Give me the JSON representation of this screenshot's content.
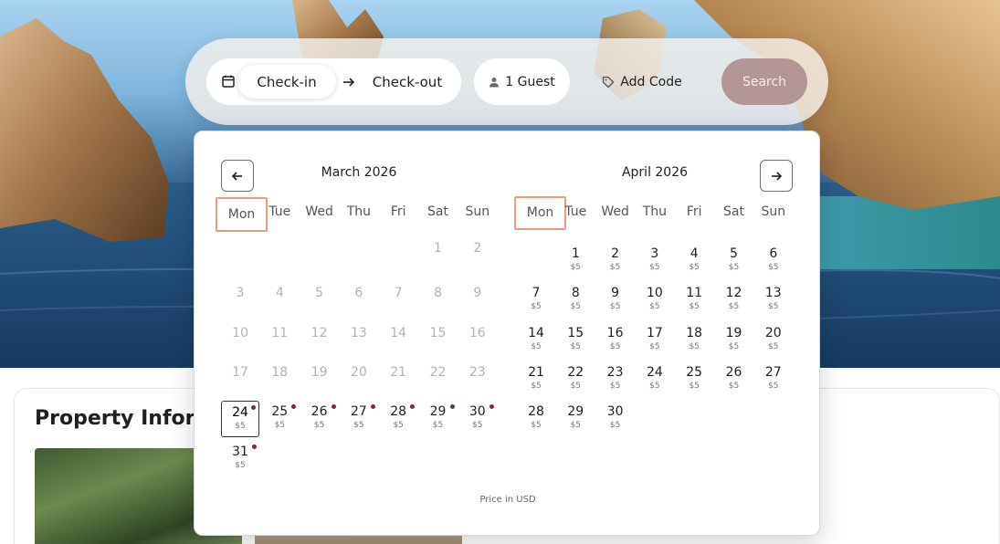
{
  "search_bar": {
    "check_in_label": "Check-in",
    "check_out_label": "Check-out",
    "guests_label": "1 Guest",
    "add_code_label": "Add Code",
    "search_label": "Search"
  },
  "property": {
    "title": "Property Informe"
  },
  "calendar": {
    "price_note": "Price in USD",
    "weekdays": [
      "Mon",
      "Tue",
      "Wed",
      "Thu",
      "Fri",
      "Sat",
      "Sun"
    ],
    "months": [
      {
        "title": "March 2026",
        "first_weekday": 6,
        "days": [
          {
            "n": "1",
            "price": "",
            "state": "past",
            "dot": false
          },
          {
            "n": "2",
            "price": "",
            "state": "past",
            "dot": false
          },
          {
            "n": "3",
            "price": "",
            "state": "past",
            "dot": false
          },
          {
            "n": "4",
            "price": "",
            "state": "past",
            "dot": false
          },
          {
            "n": "5",
            "price": "",
            "state": "past",
            "dot": false
          },
          {
            "n": "6",
            "price": "",
            "state": "past",
            "dot": false
          },
          {
            "n": "7",
            "price": "",
            "state": "past",
            "dot": false
          },
          {
            "n": "8",
            "price": "",
            "state": "past",
            "dot": false
          },
          {
            "n": "9",
            "price": "",
            "state": "past",
            "dot": false
          },
          {
            "n": "10",
            "price": "",
            "state": "past",
            "dot": false
          },
          {
            "n": "11",
            "price": "",
            "state": "past",
            "dot": false
          },
          {
            "n": "12",
            "price": "",
            "state": "past",
            "dot": false
          },
          {
            "n": "13",
            "price": "",
            "state": "past",
            "dot": false
          },
          {
            "n": "14",
            "price": "",
            "state": "past",
            "dot": false
          },
          {
            "n": "15",
            "price": "",
            "state": "past",
            "dot": false
          },
          {
            "n": "16",
            "price": "",
            "state": "past",
            "dot": false
          },
          {
            "n": "17",
            "price": "",
            "state": "past",
            "dot": false
          },
          {
            "n": "18",
            "price": "",
            "state": "past",
            "dot": false
          },
          {
            "n": "19",
            "price": "",
            "state": "past",
            "dot": false
          },
          {
            "n": "20",
            "price": "",
            "state": "past",
            "dot": false
          },
          {
            "n": "21",
            "price": "",
            "state": "past",
            "dot": false
          },
          {
            "n": "22",
            "price": "",
            "state": "past",
            "dot": false
          },
          {
            "n": "23",
            "price": "",
            "state": "past",
            "dot": false
          },
          {
            "n": "24",
            "price": "$5",
            "state": "selected",
            "dot": true
          },
          {
            "n": "25",
            "price": "$5",
            "state": "avail",
            "dot": true
          },
          {
            "n": "26",
            "price": "$5",
            "state": "avail",
            "dot": true
          },
          {
            "n": "27",
            "price": "$5",
            "state": "avail",
            "dot": true
          },
          {
            "n": "28",
            "price": "$5",
            "state": "avail",
            "dot": true
          },
          {
            "n": "29",
            "price": "$5",
            "state": "avail",
            "dot": true
          },
          {
            "n": "30",
            "price": "$5",
            "state": "avail",
            "dot": true
          },
          {
            "n": "31",
            "price": "$5",
            "state": "avail",
            "dot": true
          }
        ]
      },
      {
        "title": "April 2026",
        "first_weekday": 2,
        "days": [
          {
            "n": "1",
            "price": "$5",
            "state": "avail",
            "dot": false
          },
          {
            "n": "2",
            "price": "$5",
            "state": "avail",
            "dot": false
          },
          {
            "n": "3",
            "price": "$5",
            "state": "avail",
            "dot": false
          },
          {
            "n": "4",
            "price": "$5",
            "state": "avail",
            "dot": false
          },
          {
            "n": "5",
            "price": "$5",
            "state": "avail",
            "dot": false
          },
          {
            "n": "6",
            "price": "$5",
            "state": "avail",
            "dot": false
          },
          {
            "n": "7",
            "price": "$5",
            "state": "avail",
            "dot": false
          },
          {
            "n": "8",
            "price": "$5",
            "state": "avail",
            "dot": false
          },
          {
            "n": "9",
            "price": "$5",
            "state": "avail",
            "dot": false
          },
          {
            "n": "10",
            "price": "$5",
            "state": "avail",
            "dot": false
          },
          {
            "n": "11",
            "price": "$5",
            "state": "avail",
            "dot": false
          },
          {
            "n": "12",
            "price": "$5",
            "state": "avail",
            "dot": false
          },
          {
            "n": "13",
            "price": "$5",
            "state": "avail",
            "dot": false
          },
          {
            "n": "14",
            "price": "$5",
            "state": "avail",
            "dot": false
          },
          {
            "n": "15",
            "price": "$5",
            "state": "avail",
            "dot": false
          },
          {
            "n": "16",
            "price": "$5",
            "state": "avail",
            "dot": false
          },
          {
            "n": "17",
            "price": "$5",
            "state": "avail",
            "dot": false
          },
          {
            "n": "18",
            "price": "$5",
            "state": "avail",
            "dot": false
          },
          {
            "n": "19",
            "price": "$5",
            "state": "avail",
            "dot": false
          },
          {
            "n": "20",
            "price": "$5",
            "state": "avail",
            "dot": false
          },
          {
            "n": "21",
            "price": "$5",
            "state": "avail",
            "dot": false
          },
          {
            "n": "22",
            "price": "$5",
            "state": "avail",
            "dot": false
          },
          {
            "n": "23",
            "price": "$5",
            "state": "avail",
            "dot": false
          },
          {
            "n": "24",
            "price": "$5",
            "state": "avail",
            "dot": false
          },
          {
            "n": "25",
            "price": "$5",
            "state": "avail",
            "dot": false
          },
          {
            "n": "26",
            "price": "$5",
            "state": "avail",
            "dot": false
          },
          {
            "n": "27",
            "price": "$5",
            "state": "avail",
            "dot": false
          },
          {
            "n": "28",
            "price": "$5",
            "state": "avail",
            "dot": false
          },
          {
            "n": "29",
            "price": "$5",
            "state": "avail",
            "dot": false
          },
          {
            "n": "30",
            "price": "$5",
            "state": "avail",
            "dot": false
          }
        ]
      }
    ]
  },
  "colors": {
    "accent_dot": "#7a2b3d",
    "weekday_highlight": "#ef9a7a",
    "search_button": "#b39696"
  },
  "icons": [
    "calendar-icon",
    "arrow-right-icon",
    "user-icon",
    "tag-icon",
    "arrow-left-icon"
  ]
}
